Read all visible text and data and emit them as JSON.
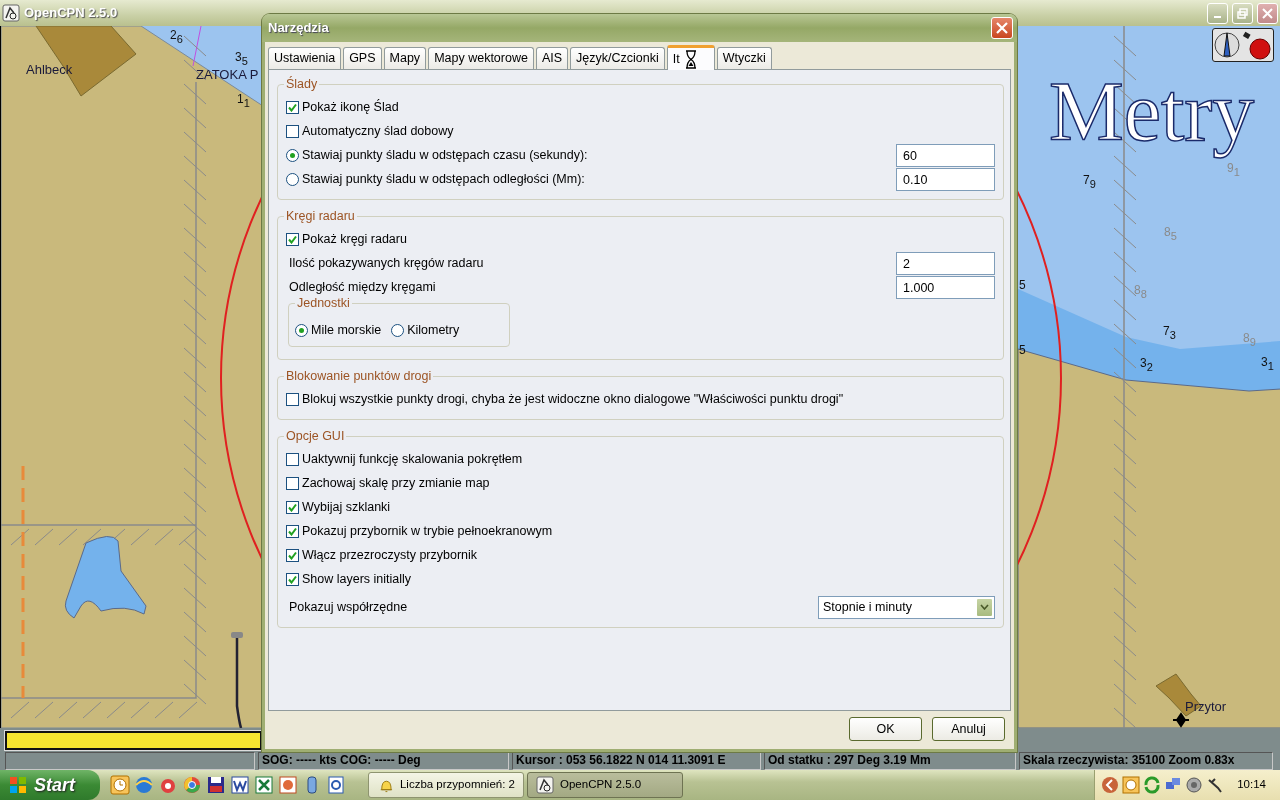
{
  "app": {
    "title": "OpenCPN 2.5.0"
  },
  "chart_view": {
    "labels": [
      {
        "kind": "place",
        "text": "Ahlbeck"
      },
      {
        "kind": "place",
        "text": "ZATOKA P"
      },
      {
        "kind": "place",
        "text": "Przytor"
      },
      {
        "kind": "units",
        "text": "Metry"
      },
      {
        "kind": "sounding",
        "text": "2$_{6}$"
      },
      {
        "kind": "sounding",
        "text": "3$_{5}$"
      },
      {
        "kind": "sounding",
        "text": "1$_{1}$"
      },
      {
        "kind": "sounding",
        "text": "7$_{9}$"
      },
      {
        "kind": "deep-sounding",
        "text": "9$_{1}$"
      },
      {
        "kind": "deep-sounding",
        "text": "8$_{5}$"
      },
      {
        "kind": "deep-sounding",
        "text": "8$_{8}$"
      },
      {
        "kind": "sounding",
        "text": "7$_{3}$"
      },
      {
        "kind": "deep-sounding",
        "text": "8$_{9}$"
      },
      {
        "kind": "sounding",
        "text": "3$_{2}$"
      },
      {
        "kind": "sounding",
        "text": "3$_{1}$"
      },
      {
        "kind": "sounding",
        "text": "5"
      },
      {
        "kind": "sounding",
        "text": "5"
      }
    ]
  },
  "dialog": {
    "title": "Narzędzia",
    "tabs": [
      {
        "label": "Ustawienia",
        "selected": false
      },
      {
        "label": "GPS",
        "selected": false
      },
      {
        "label": "Mapy",
        "selected": false
      },
      {
        "label": "Mapy wektorowe",
        "selected": false
      },
      {
        "label": "AIS",
        "selected": false
      },
      {
        "label": "Język/Czcionki",
        "selected": false
      },
      {
        "label": "It",
        "selected": true
      },
      {
        "label": "Wtyczki",
        "selected": false
      }
    ],
    "groups": [
      {
        "title": "Ślady",
        "items": [
          {
            "kind": "checkbox",
            "label": "Pokaż ikonę Ślad",
            "checked": true
          },
          {
            "kind": "checkbox",
            "label": "Automatyczny ślad dobowy",
            "checked": false
          },
          {
            "kind": "radio",
            "label": "Stawiaj punkty śladu w odstępach czasu (sekundy):",
            "selected": true,
            "value": "60"
          },
          {
            "kind": "radio",
            "label": "Stawiaj punkty śladu w odstępach odległości (Mm):",
            "selected": false,
            "value": "0.10"
          }
        ]
      },
      {
        "title": "Kręgi radaru",
        "items": [
          {
            "kind": "checkbox",
            "label": "Pokaż kręgi radaru",
            "checked": true
          },
          {
            "kind": "field",
            "label": "Ilość pokazywanych kręgów radaru",
            "value": "2"
          },
          {
            "kind": "field",
            "label": "Odległość między kręgami",
            "value": "1.000"
          },
          {
            "kind": "subgroup",
            "title": "Jednostki",
            "options": [
              {
                "label": "Mile morskie",
                "selected": true
              },
              {
                "label": "Kilometry",
                "selected": false
              }
            ]
          }
        ]
      },
      {
        "title": "Blokowanie punktów drogi",
        "items": [
          {
            "kind": "checkbox",
            "label": "Blokuj wszystkie punkty drogi, chyba że jest widoczne okno dialogowe \"Właściwości punktu drogi\"",
            "checked": false
          }
        ]
      },
      {
        "title": "Opcje GUI",
        "items": [
          {
            "kind": "checkbox",
            "label": "Uaktywnij funkcję skalowania pokrętłem",
            "checked": false
          },
          {
            "kind": "checkbox",
            "label": "Zachowaj skalę przy zmianie map",
            "checked": false
          },
          {
            "kind": "checkbox",
            "label": "Wybijaj szklanki",
            "checked": true
          },
          {
            "kind": "checkbox",
            "label": "Pokazuj przybornik w trybie pełnoekranowym",
            "checked": true
          },
          {
            "kind": "checkbox",
            "label": "Włącz przezroczysty przybornik",
            "checked": true
          },
          {
            "kind": "checkbox",
            "label": "Show layers initially",
            "checked": true
          },
          {
            "kind": "select",
            "label": "Pokazuj współrzędne",
            "value": "Stopnie i minuty"
          }
        ]
      }
    ],
    "buttons": [
      {
        "label": "OK"
      },
      {
        "label": "Anuluj"
      }
    ]
  },
  "status_bar": [
    "SOG: ----- kts  COG: ----- Deg",
    "Kursor :  053 56.1822 N 014 11.3091 E",
    "Od statku :  297 Deg     3.19 Mm",
    "Skala rzeczywista:    35100  Zoom 0.83x"
  ],
  "taskbar": {
    "start": "Start",
    "tasks": [
      {
        "label": "Liczba przypomnień: 2",
        "selected": false
      },
      {
        "label": "OpenCPN 2.5.0",
        "selected": true
      }
    ],
    "clock": "10:14"
  }
}
